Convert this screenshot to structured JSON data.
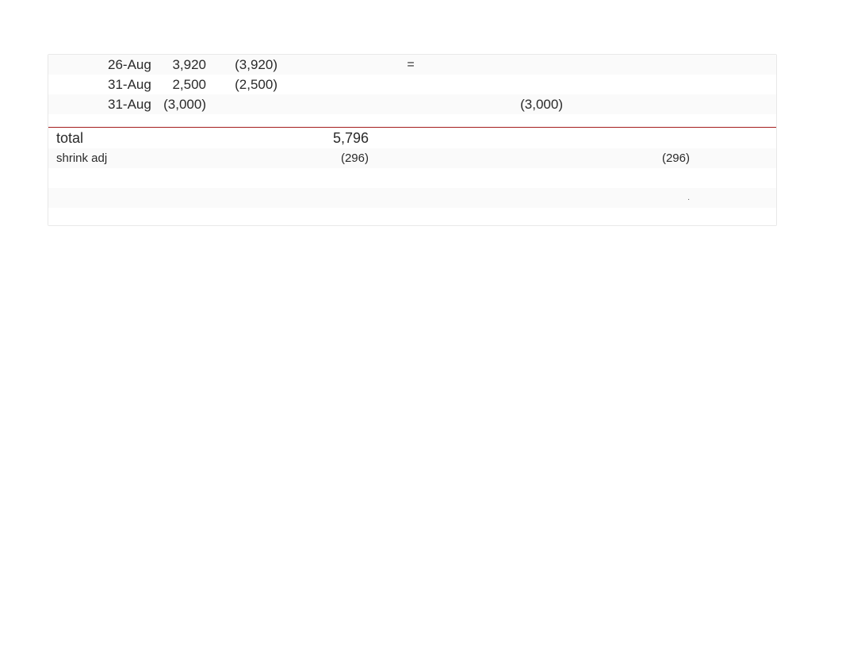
{
  "rows": [
    {
      "date": "26-Aug",
      "qty": "3,920",
      "amt1": "(3,920)",
      "mid": "=",
      "far": "",
      "end": ""
    },
    {
      "date": "31-Aug",
      "qty": "2,500",
      "amt1": "(2,500)",
      "mid": "",
      "far": "",
      "end": ""
    },
    {
      "date": "31-Aug",
      "qty": "(3,000)",
      "amt1": "",
      "mid": "",
      "far": "(3,000)",
      "end": ""
    }
  ],
  "total": {
    "label": "total",
    "value": "5,796"
  },
  "shrink": {
    "label": "shrink adj",
    "amt2": "(296)",
    "end": "(296)"
  },
  "dot": "."
}
